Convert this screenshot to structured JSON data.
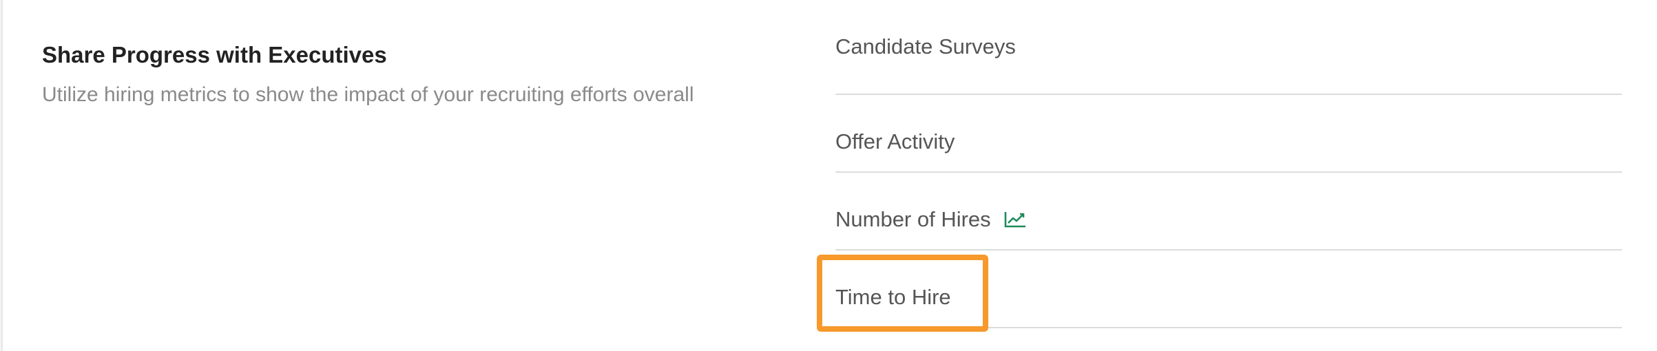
{
  "section": {
    "title": "Share Progress with Executives",
    "description": "Utilize hiring metrics to show the impact of your recruiting efforts overall"
  },
  "reports": [
    {
      "label": "Candidate Surveys",
      "icon": null
    },
    {
      "label": "Offer Activity",
      "icon": null
    },
    {
      "label": "Number of Hires",
      "icon": "trend-chart-icon"
    },
    {
      "label": "Time to Hire",
      "icon": null,
      "highlighted": true
    }
  ],
  "colors": {
    "highlight": "#f7992b",
    "icon": "#1f8a5b"
  }
}
